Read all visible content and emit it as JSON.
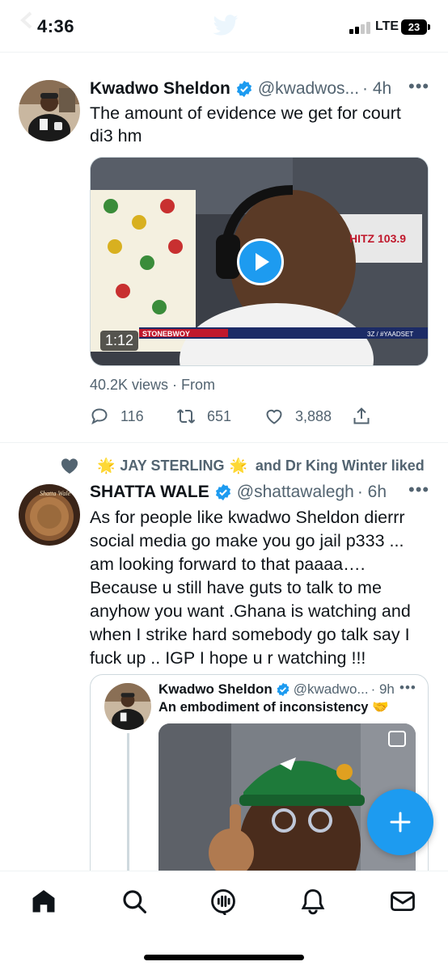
{
  "status_bar": {
    "time": "4:36",
    "network": "LTE",
    "battery": "23"
  },
  "tweet1": {
    "author_name": "Kwadwo Sheldon",
    "handle": "@kwadwos...",
    "time": "· 4h",
    "text_lines": [
      "The amount of evidence we get for court",
      "di3 hm"
    ],
    "video": {
      "duration": "1:12",
      "overlay_logo": "HITZ 103.9",
      "banner_text": "STONEBWOY",
      "banner_tag": "3Z / #YAADSET"
    },
    "meta": "40.2K views · From",
    "actions": {
      "reply_count": "116",
      "retweet_count": "651",
      "like_count": "3,888"
    }
  },
  "tweet2": {
    "social_context": {
      "name1": "JAY STERLING",
      "connector": "and Dr King Winter liked",
      "sparkle": "🌟"
    },
    "author_name": "SHATTA WALE",
    "handle": "@shattawalegh",
    "time": "· 6h",
    "text_lines": [
      "As for people like kwadwo Sheldon  dierrr",
      "social media go make you go jail p333 ...",
      "am looking forward to that paaaa….",
      "Because u still have guts to talk to me",
      "anyhow you want .Ghana is watching and",
      "when I strike hard somebody go talk say I",
      "fuck up .. IGP I hope u r watching !!!"
    ],
    "quote": {
      "author_name": "Kwadwo Sheldon",
      "handle": "@kwadwo...",
      "time": "· 9h",
      "text": "An embodiment of inconsistency 🤝"
    }
  },
  "icons": {
    "verified": "verified-badge-icon",
    "more": "more-icon",
    "reply": "reply-icon",
    "retweet": "retweet-icon",
    "like": "heart-icon",
    "share": "share-icon",
    "compose": "plus-icon",
    "nav": [
      "home-icon",
      "search-icon",
      "spaces-icon",
      "notifications-icon",
      "messages-icon"
    ]
  },
  "colors": {
    "accent": "#1d9bf0",
    "text_primary": "#0f1419",
    "text_secondary": "#536471"
  }
}
